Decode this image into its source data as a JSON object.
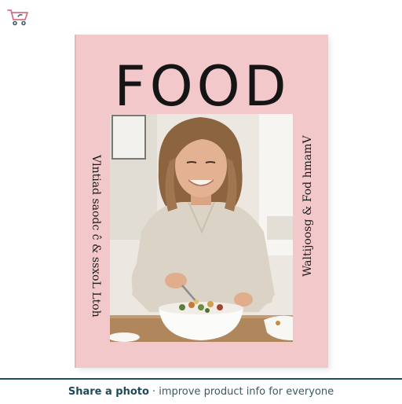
{
  "icons": {
    "cart": "shopping-cart-icon"
  },
  "book": {
    "title": "FOOD",
    "spine_left": "Vlntiad saodc ĉ & ssxoL Ltoh",
    "spine_right": "Waltijoosg & Fod hmamV",
    "cover_color": "#f2c8cb"
  },
  "footer": {
    "share_label": "Share a photo",
    "share_rest": "· improve product info for everyone",
    "accent": "#1e4d5c"
  }
}
